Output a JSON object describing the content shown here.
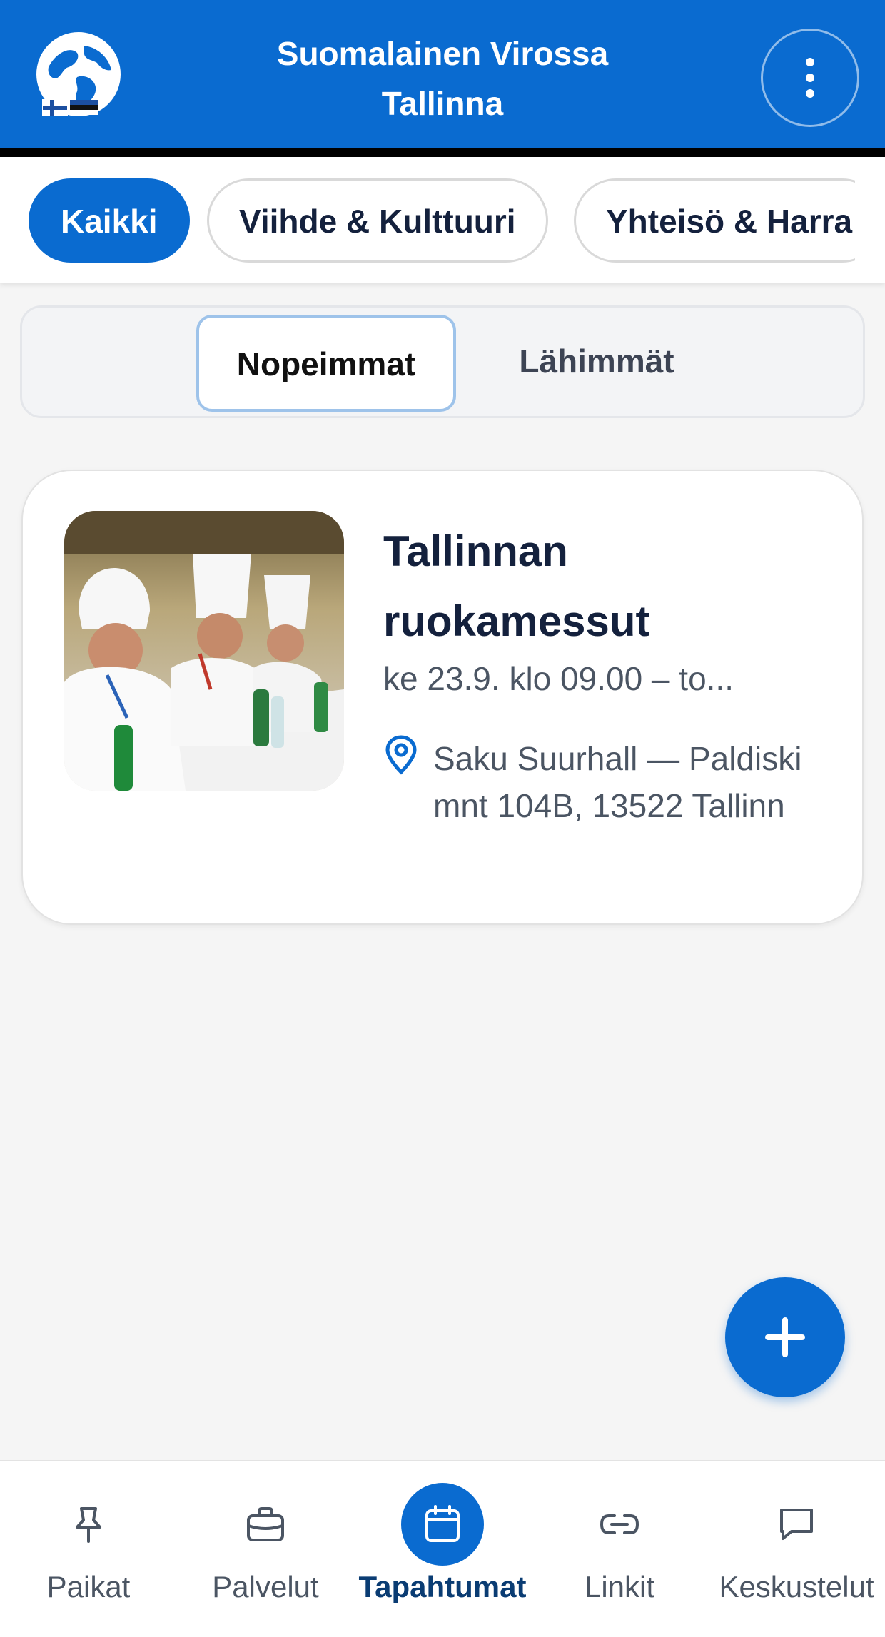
{
  "header": {
    "title_line1": "Suomalainen Virossa",
    "title_line2": "Tallinna",
    "menu_icon": "more-vertical-icon",
    "logo_icon": "globe-flags-logo",
    "brand_color": "#0a6bd0"
  },
  "categories": [
    {
      "label": "Kaikki",
      "active": true
    },
    {
      "label": "Viihde & Kulttuuri",
      "active": false
    },
    {
      "label": "Yhteisö & Harra",
      "active": false
    }
  ],
  "sort": {
    "options": [
      "Nopeimmat",
      "Lähimmät"
    ],
    "selected": "Nopeimmat"
  },
  "events": [
    {
      "title": "Tallinnan ruokamessut",
      "date": "ke 23.9. klo 09.00 – to...",
      "address": "Saku Suurhall — Paldiski mnt 104B, 13522 Tallinn",
      "image": "chefs-at-table-photo",
      "location_icon": "map-pin-icon"
    }
  ],
  "fab": {
    "icon": "plus-icon"
  },
  "bottom_nav": [
    {
      "label": "Paikat",
      "icon": "pin-icon",
      "active": false
    },
    {
      "label": "Palvelut",
      "icon": "briefcase-icon",
      "active": false
    },
    {
      "label": "Tapahtumat",
      "icon": "calendar-icon",
      "active": true
    },
    {
      "label": "Linkit",
      "icon": "link-icon",
      "active": false
    },
    {
      "label": "Keskustelut",
      "icon": "chat-icon",
      "active": false
    }
  ]
}
